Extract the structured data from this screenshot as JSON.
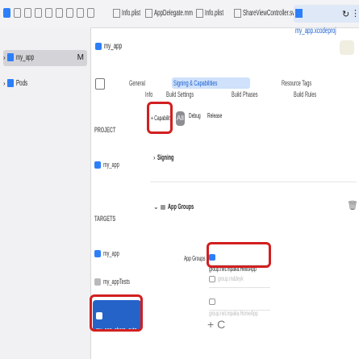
{
  "toolbar": {
    "tabs": [
      {
        "label": "Info.plist"
      },
      {
        "label": "AppDelegate.mm"
      },
      {
        "label": "Info.plist"
      },
      {
        "label": "ShareViewController.swift"
      },
      {
        "label": "my_app.xcodeproj"
      }
    ]
  },
  "navigator": {
    "items": [
      {
        "label": "my_app",
        "badge": "M"
      },
      {
        "label": "Pods"
      }
    ]
  },
  "editor": {
    "breadcrumb": "my_app",
    "tabs": [
      "General",
      "Signing & Capabilities",
      "Resource Tags",
      "Info",
      "Build Settings",
      "Build Phases",
      "Build Rules"
    ],
    "project_header": "PROJECT",
    "project_item": "my_app",
    "targets_header": "TARGETS",
    "targets": [
      "my_app",
      "my_appTests",
      "my_app_share_exte..."
    ],
    "capability_button": "+ Capability",
    "config_tabs": [
      "All",
      "Debug",
      "Release"
    ],
    "signing_label": "Signing",
    "app_groups_label": "App Groups",
    "app_groups_field_label": "App Groups",
    "groups": [
      {
        "label": "group.net.mpaka.HelloApp",
        "checked": true
      },
      {
        "label": "group.rnddeyk",
        "checked": false
      },
      {
        "label": "group.net.mpaka.HomeApp",
        "checked": false
      }
    ],
    "add_remove": "+ C"
  }
}
